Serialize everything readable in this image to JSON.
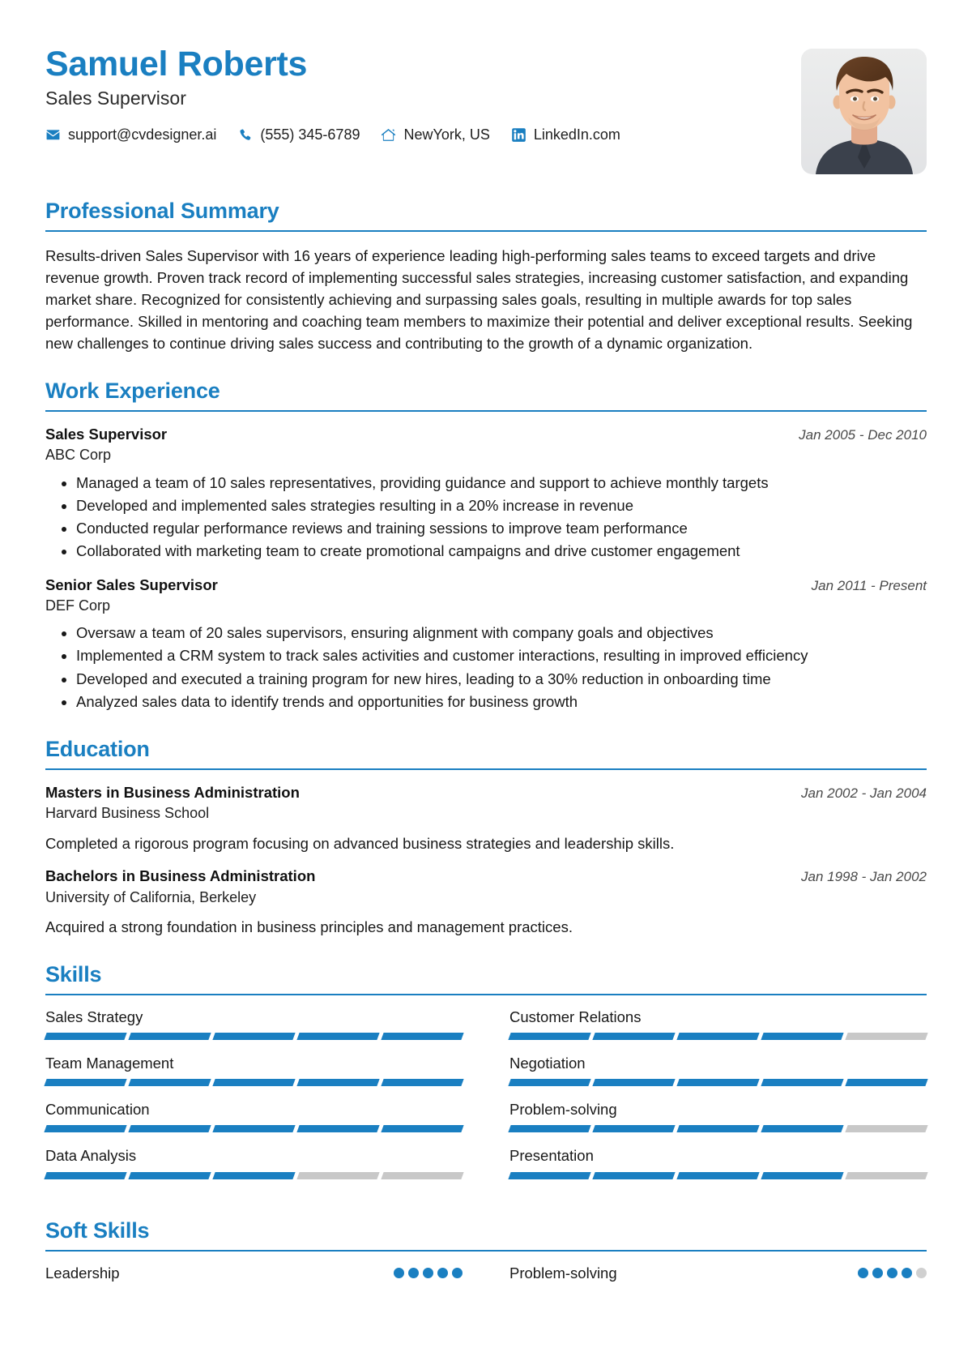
{
  "theme": {
    "accent": "#1a7fc1",
    "muted": "#c8c8c8",
    "text": "#181818"
  },
  "header": {
    "full_name": "Samuel Roberts",
    "job_title": "Sales Supervisor",
    "contacts": [
      {
        "icon": "envelope-icon",
        "value": "support@cvdesigner.ai"
      },
      {
        "icon": "phone-icon",
        "value": "(555) 345-6789"
      },
      {
        "icon": "home-icon",
        "value": "NewYork, US"
      },
      {
        "icon": "linkedin-icon",
        "value": "LinkedIn.com"
      }
    ],
    "photo_alt": "profile-photo"
  },
  "sections": {
    "summary": {
      "title": "Professional Summary",
      "text": "Results-driven Sales Supervisor with 16 years of experience leading high-performing sales teams to exceed targets and drive revenue growth. Proven track record of implementing successful sales strategies, increasing customer satisfaction, and expanding market share. Recognized for consistently achieving and surpassing sales goals, resulting in multiple awards for top sales performance. Skilled in mentoring and coaching team members to maximize their potential and deliver exceptional results. Seeking new challenges to continue driving sales success and contributing to the growth of a dynamic organization."
    },
    "experience": {
      "title": "Work Experience",
      "entries": [
        {
          "role": "Sales Supervisor",
          "company": "ABC Corp",
          "date": "Jan 2005 - Dec 2010",
          "bullets": [
            "Managed a team of 10 sales representatives, providing guidance and support to achieve monthly targets",
            "Developed and implemented sales strategies resulting in a 20% increase in revenue",
            "Conducted regular performance reviews and training sessions to improve team performance",
            "Collaborated with marketing team to create promotional campaigns and drive customer engagement"
          ]
        },
        {
          "role": "Senior Sales Supervisor",
          "company": "DEF Corp",
          "date": "Jan 2011 - Present",
          "bullets": [
            "Oversaw a team of 20 sales supervisors, ensuring alignment with company goals and objectives",
            "Implemented a CRM system to track sales activities and customer interactions, resulting in improved efficiency",
            "Developed and executed a training program for new hires, leading to a 30% reduction in onboarding time",
            "Analyzed sales data to identify trends and opportunities for business growth"
          ]
        }
      ]
    },
    "education": {
      "title": "Education",
      "entries": [
        {
          "degree": "Masters in Business Administration",
          "school": "Harvard Business School",
          "date": "Jan 2002 - Jan 2004",
          "description": "Completed a rigorous program focusing on advanced business strategies and leadership skills."
        },
        {
          "degree": "Bachelors in Business Administration",
          "school": "University of California, Berkeley",
          "date": "Jan 1998 - Jan 2002",
          "description": "Acquired a strong foundation in business principles and management practices."
        }
      ]
    },
    "skills": {
      "title": "Skills",
      "segments_total": 5,
      "items": [
        {
          "name": "Sales Strategy",
          "filled": 5
        },
        {
          "name": "Customer Relations",
          "filled": 4
        },
        {
          "name": "Team Management",
          "filled": 5
        },
        {
          "name": "Negotiation",
          "filled": 5
        },
        {
          "name": "Communication",
          "filled": 5
        },
        {
          "name": "Problem-solving",
          "filled": 4
        },
        {
          "name": "Data Analysis",
          "filled": 3
        },
        {
          "name": "Presentation",
          "filled": 4
        }
      ]
    },
    "soft_skills": {
      "title": "Soft Skills",
      "dots_total": 5,
      "items": [
        {
          "name": "Leadership",
          "filled": 5
        },
        {
          "name": "Problem-solving",
          "filled": 4
        }
      ]
    }
  }
}
